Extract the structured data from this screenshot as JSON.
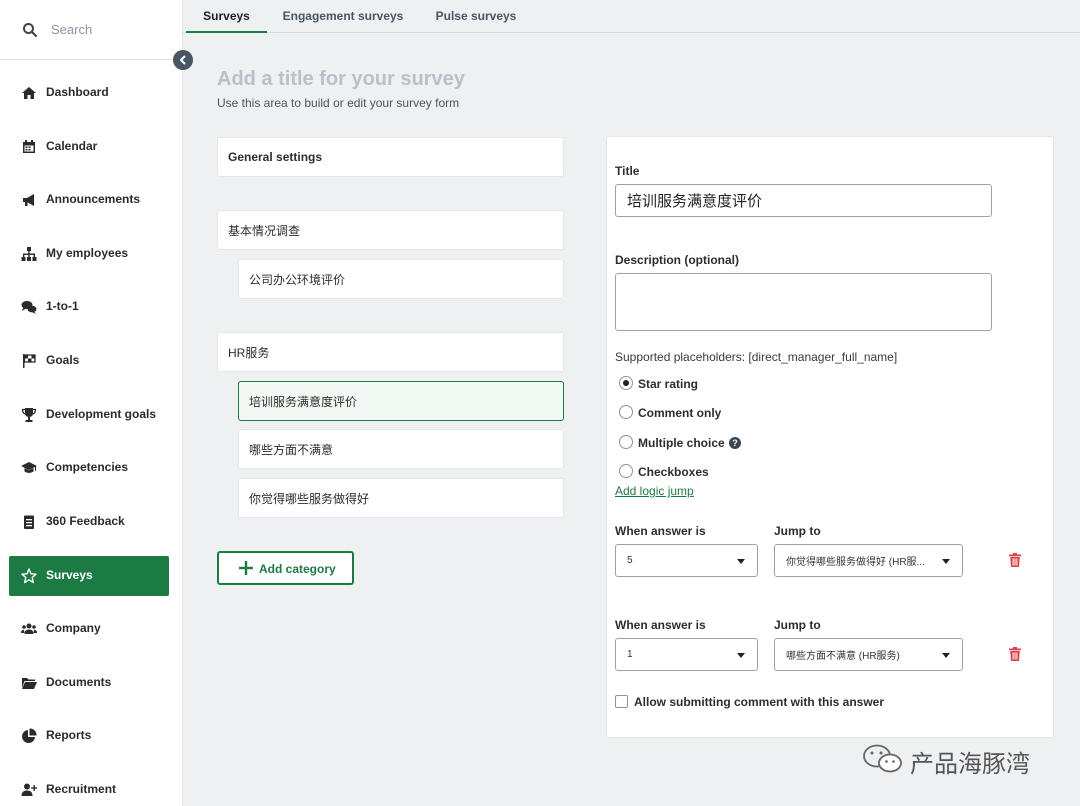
{
  "search": {
    "placeholder": "Search"
  },
  "nav": [
    {
      "label": "Dashboard",
      "icon": "home-icon"
    },
    {
      "label": "Calendar",
      "icon": "calendar-icon"
    },
    {
      "label": "Announcements",
      "icon": "megaphone-icon"
    },
    {
      "label": "My employees",
      "icon": "org-chart-icon"
    },
    {
      "label": "1-to-1",
      "icon": "chat-icon"
    },
    {
      "label": "Goals",
      "icon": "flag-icon"
    },
    {
      "label": "Development goals",
      "icon": "trophy-icon"
    },
    {
      "label": "Competencies",
      "icon": "graduation-cap-icon"
    },
    {
      "label": "360 Feedback",
      "icon": "clipboard-icon"
    },
    {
      "label": "Surveys",
      "icon": "star-icon",
      "active": true
    },
    {
      "label": "Company",
      "icon": "users-icon"
    },
    {
      "label": "Documents",
      "icon": "folder-icon"
    },
    {
      "label": "Reports",
      "icon": "pie-chart-icon"
    },
    {
      "label": "Recruitment",
      "icon": "user-plus-icon"
    }
  ],
  "tabs": [
    {
      "label": "Surveys",
      "active": true
    },
    {
      "label": "Engagement surveys"
    },
    {
      "label": "Pulse surveys"
    }
  ],
  "page": {
    "title": "Add a title for your survey",
    "subtitle": "Use this area to build or edit your survey form"
  },
  "structure": {
    "general_settings": "General settings",
    "category1": {
      "title": "基本情况调查",
      "questions": [
        "公司办公环境评价"
      ]
    },
    "category2": {
      "title": "HR服务",
      "questions": [
        "培训服务满意度评价",
        "哪些方面不满意",
        "你觉得哪些服务做得好"
      ]
    },
    "add_category": "Add category"
  },
  "form": {
    "title_label": "Title",
    "title_value": "培训服务满意度评价",
    "description_label": "Description (optional)",
    "description_value": "",
    "placeholders_text": "Supported placeholders: [direct_manager_full_name]",
    "options": [
      {
        "label": "Star rating",
        "selected": true
      },
      {
        "label": "Comment only"
      },
      {
        "label": "Multiple choice"
      },
      {
        "label": "Checkboxes"
      }
    ],
    "add_logic_jump": "Add logic jump",
    "rules": [
      {
        "when_label": "When answer is",
        "when_value": "5",
        "jump_label": "Jump to",
        "jump_value": "你觉得哪些服务做得好 (HR服..."
      },
      {
        "when_label": "When answer is",
        "when_value": "1",
        "jump_label": "Jump to",
        "jump_value": "哪些方面不满意 (HR服务)"
      }
    ],
    "allow_comment": "Allow submitting comment with this answer"
  },
  "watermark": "产品海豚湾",
  "colors": {
    "accent": "#1c7a43",
    "danger": "#d9434f"
  }
}
